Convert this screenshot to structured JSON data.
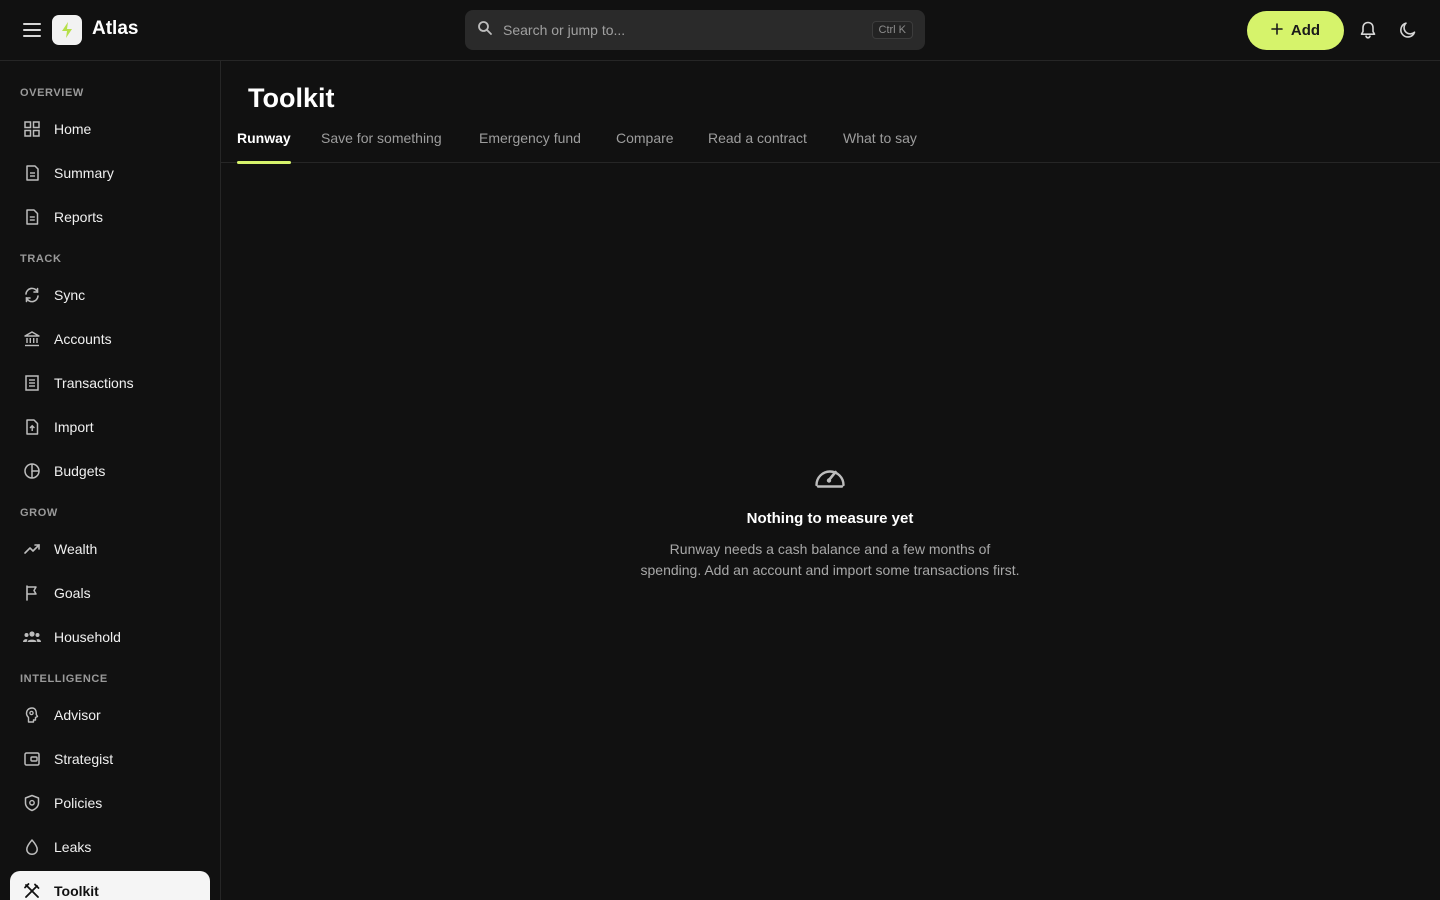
{
  "header": {
    "brand": "Atlas",
    "search_placeholder": "Search or jump to...",
    "shortcut": "Ctrl K",
    "add_label": "Add"
  },
  "sidebar": {
    "sections": [
      {
        "label": "OVERVIEW"
      },
      {
        "label": "TRACK"
      },
      {
        "label": "GROW"
      },
      {
        "label": "INTELLIGENCE"
      }
    ],
    "items": [
      {
        "label": "Home"
      },
      {
        "label": "Summary"
      },
      {
        "label": "Reports"
      },
      {
        "label": "Sync"
      },
      {
        "label": "Accounts"
      },
      {
        "label": "Transactions"
      },
      {
        "label": "Import"
      },
      {
        "label": "Budgets"
      },
      {
        "label": "Wealth"
      },
      {
        "label": "Goals"
      },
      {
        "label": "Household"
      },
      {
        "label": "Advisor"
      },
      {
        "label": "Strategist"
      },
      {
        "label": "Policies"
      },
      {
        "label": "Leaks"
      },
      {
        "label": "Toolkit"
      }
    ]
  },
  "main": {
    "title": "Toolkit",
    "tabs": [
      {
        "label": "Runway"
      },
      {
        "label": "Save for something"
      },
      {
        "label": "Emergency fund"
      },
      {
        "label": "Compare"
      },
      {
        "label": "Read a contract"
      },
      {
        "label": "What to say"
      }
    ],
    "empty": {
      "title": "Nothing to measure yet",
      "description": "Runway needs a cash balance and a few months of spending. Add an account and import some transactions first."
    }
  },
  "colors": {
    "accent": "#d6f36b",
    "background": "#111111",
    "active_nav": "#f5f5f5"
  }
}
